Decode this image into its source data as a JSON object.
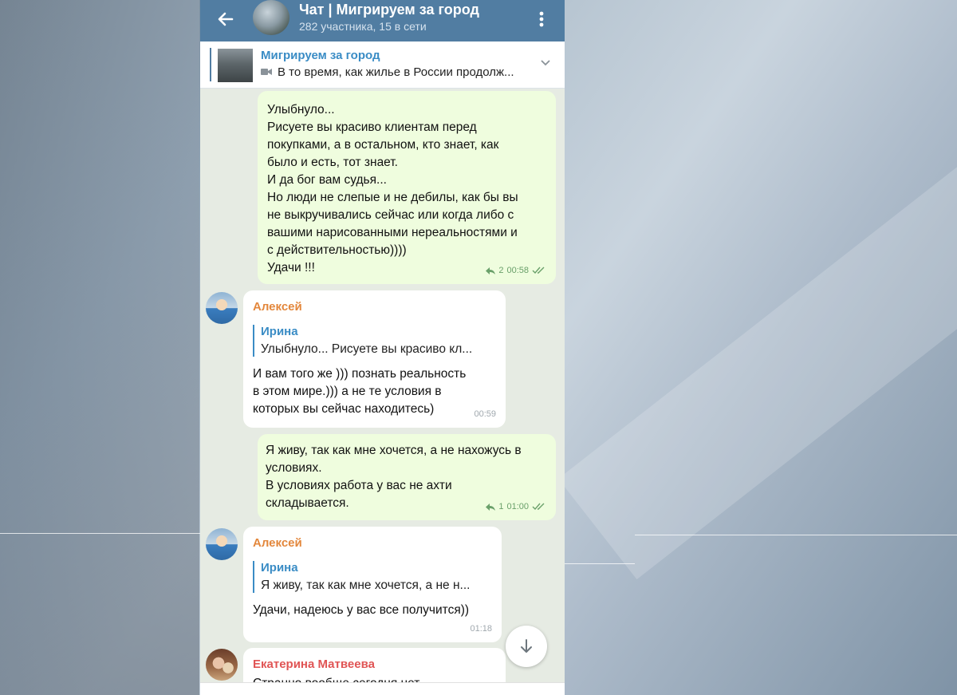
{
  "chat": {
    "title": "Чат | Мигрируем за город",
    "subtitle": "282 участника, 15 в сети"
  },
  "pinned": {
    "title": "Мигрируем за город",
    "text": "В то время, как жилье в России продолж..."
  },
  "messages": [
    {
      "type": "outgoing",
      "text": "Улыбнуло...\nРисуете вы красиво клиентам перед\nпокупками, а в остальном, кто знает, как\nбыло и есть, тот знает.\nИ да бог вам судья...\nНо люди не слепые и не дебилы, как бы вы\nне выкручивались сейчас или когда либо с\nвашими нарисованными нереальностями и\nс действительностью))))\nУдачи !!!",
      "replies": "2",
      "time": "00:58"
    },
    {
      "type": "incoming",
      "sender": "Алексей",
      "sender_color": "#e3873c",
      "quote_name": "Ирина",
      "quote_text": "Улыбнуло... Рисуете вы красиво кл...",
      "text": "И вам того же ))) познать реальность\nв этом мире.))) а не те условия в\nкоторых вы сейчас находитесь)",
      "time": "00:59"
    },
    {
      "type": "outgoing",
      "text": "Я живу, так как мне хочется, а не нахожусь в\nусловиях.\nВ условиях работа у вас не ахти\nскладывается.",
      "replies": "1",
      "time": "01:00"
    },
    {
      "type": "incoming",
      "sender": "Алексей",
      "sender_color": "#e3873c",
      "quote_name": "Ирина",
      "quote_text": "Я живу, так как мне хочется, а не н...",
      "text": "Удачи, надеюсь у вас все получится))",
      "time": "01:18"
    },
    {
      "type": "incoming",
      "sender": "Екатерина Матвеева",
      "sender_color": "#e05454",
      "text": "Странно вообще сегодня нет..."
    }
  ],
  "colors": {
    "header": "#517da2",
    "outgoing_bubble": "#effdde",
    "incoming_bubble": "#ffffff",
    "chat_background": "#e6ebe3"
  }
}
